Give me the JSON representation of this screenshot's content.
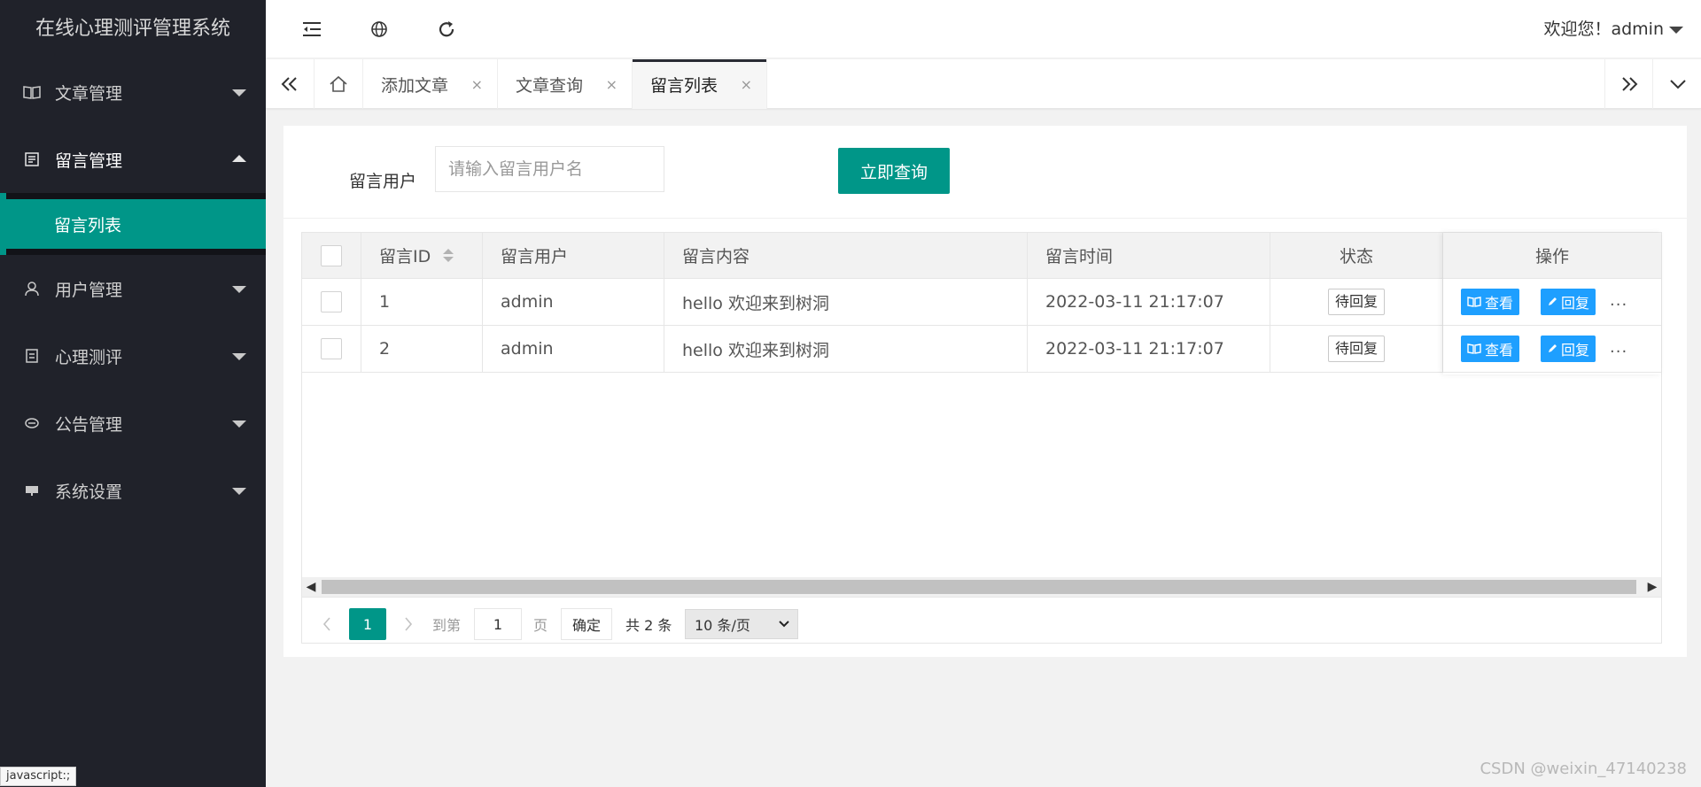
{
  "app": {
    "title": "在线心理测评管理系统"
  },
  "sidebar": {
    "items": [
      {
        "label": "文章管理",
        "icon": "book-icon",
        "open": false
      },
      {
        "label": "留言管理",
        "icon": "message-icon",
        "open": true
      },
      {
        "label": "用户管理",
        "icon": "user-icon",
        "open": false
      },
      {
        "label": "心理测评",
        "icon": "test-icon",
        "open": false
      },
      {
        "label": "公告管理",
        "icon": "announcement-icon",
        "open": false
      },
      {
        "label": "系统设置",
        "icon": "settings-icon",
        "open": false
      }
    ],
    "subitems": [
      {
        "label": "留言列表",
        "active": true
      }
    ]
  },
  "header": {
    "icons": [
      "menu-fold-icon",
      "globe-icon",
      "refresh-icon"
    ],
    "welcome": "欢迎您！admin"
  },
  "tabs": [
    {
      "label": "添加文章",
      "active": false
    },
    {
      "label": "文章查询",
      "active": false
    },
    {
      "label": "留言列表",
      "active": true
    }
  ],
  "tab_close": "×",
  "search": {
    "label": "留言用户",
    "placeholder": "请输入留言用户名",
    "value": "",
    "button": "立即查询"
  },
  "table": {
    "columns": [
      "留言ID",
      "留言用户",
      "留言内容",
      "留言时间",
      "状态",
      "操作"
    ],
    "rows": [
      {
        "id": "1",
        "user": "admin",
        "content": "hello 欢迎来到树洞",
        "time": "2022-03-11 21:17:07",
        "status": "待回复"
      },
      {
        "id": "2",
        "user": "admin",
        "content": "hello 欢迎来到树洞",
        "time": "2022-03-11 21:17:07",
        "status": "待回复"
      }
    ],
    "actions": {
      "view": "查看",
      "reply": "回复",
      "more": "..."
    }
  },
  "pager": {
    "current": "1",
    "goto_prefix": "到第",
    "goto_value": "1",
    "goto_suffix": "页",
    "confirm": "确定",
    "total": "共 2 条",
    "page_size": "10 条/页"
  },
  "statusbar": "javascript:;",
  "watermark": "CSDN @weixin_47140238",
  "colors": {
    "primary": "#009688",
    "sidebar": "#20222a",
    "blue": "#1e9fff"
  }
}
